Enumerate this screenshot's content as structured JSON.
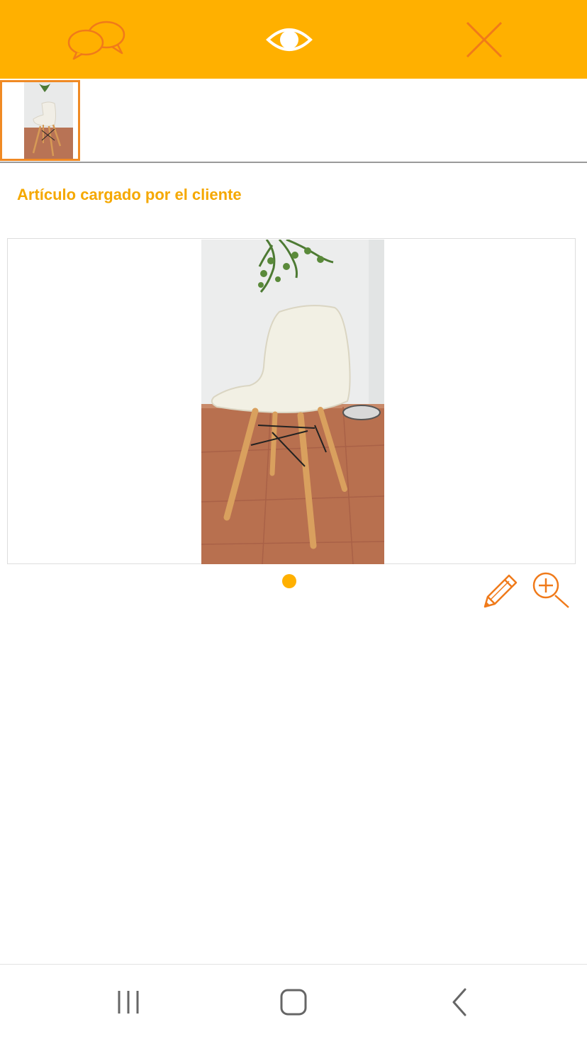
{
  "colors": {
    "accent": "#ffb000",
    "icon_orange": "#f07a1a",
    "title_orange": "#f5a800"
  },
  "toolbar": {
    "left_icon": "chat-bubbles-icon",
    "center_icon": "eye-icon",
    "right_icon": "close-icon"
  },
  "thumbnails": [
    {
      "icon": "chair-photo-thumbnail",
      "selected": true
    }
  ],
  "main": {
    "title": "Artículo cargado por el cliente",
    "image_icon": "chair-photo",
    "page_indicator": {
      "current": 1,
      "total": 1
    }
  },
  "actions": {
    "edit_icon": "pencil-icon",
    "zoom_icon": "zoom-in-icon"
  },
  "system_nav": {
    "recents_icon": "recents-icon",
    "home_icon": "home-icon",
    "back_icon": "back-icon"
  }
}
